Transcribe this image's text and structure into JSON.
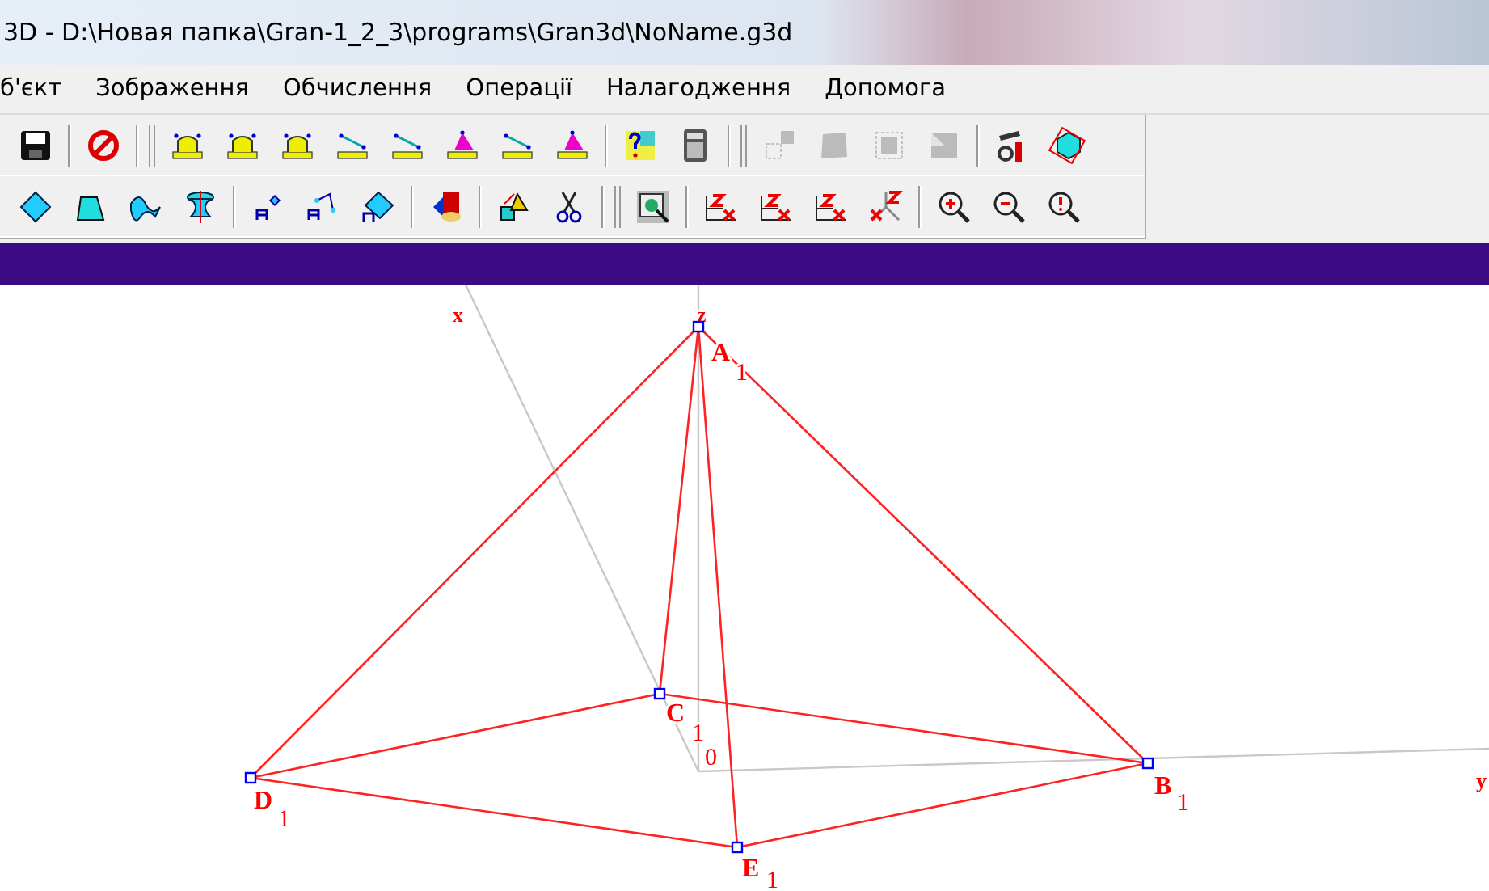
{
  "window": {
    "title": "3D - D:\\Новая папка\\Gran-1_2_3\\programs\\Gran3d\\NoName.g3d"
  },
  "menu": [
    {
      "label": "б'єкт"
    },
    {
      "label": "Зображення"
    },
    {
      "label": "Обчислення"
    },
    {
      "label": "Операції"
    },
    {
      "label": "Налагодження"
    },
    {
      "label": "Допомога"
    }
  ],
  "toolbar_1": [
    {
      "disabled": false
    },
    {
      "disabled": false
    },
    {
      "disabled": false
    },
    {
      "disabled": false
    },
    {
      "disabled": false
    },
    {
      "disabled": false
    },
    {
      "disabled": false
    },
    {
      "disabled": false
    },
    {
      "disabled": false
    },
    {
      "disabled": false
    },
    {
      "disabled": false
    },
    {
      "disabled": false
    },
    {
      "disabled": true
    },
    {
      "disabled": true
    },
    {
      "disabled": true
    },
    {
      "disabled": true
    },
    {
      "disabled": false
    },
    {
      "disabled": false
    }
  ],
  "toolbar_2": [
    {
      "disabled": false
    },
    {
      "disabled": false
    },
    {
      "disabled": false
    },
    {
      "disabled": false
    },
    {
      "disabled": false
    },
    {
      "disabled": false
    },
    {
      "disabled": false
    },
    {
      "disabled": false
    },
    {
      "disabled": false
    },
    {
      "disabled": false
    },
    {
      "disabled": false
    },
    {
      "disabled": false
    },
    {
      "disabled": false
    },
    {
      "disabled": false
    },
    {
      "disabled": false
    },
    {
      "disabled": false
    },
    {
      "disabled": false
    },
    {
      "disabled": false
    }
  ],
  "diagram": {
    "axes": [
      {
        "label": "x"
      },
      {
        "label": "z"
      },
      {
        "label": "y"
      }
    ],
    "origin_label": "0",
    "points": [
      {
        "name": "A",
        "index": "1"
      },
      {
        "name": "B",
        "index": "1"
      },
      {
        "name": "C",
        "index": "1"
      },
      {
        "name": "D",
        "index": "1"
      },
      {
        "name": "E",
        "index": "1"
      }
    ]
  }
}
